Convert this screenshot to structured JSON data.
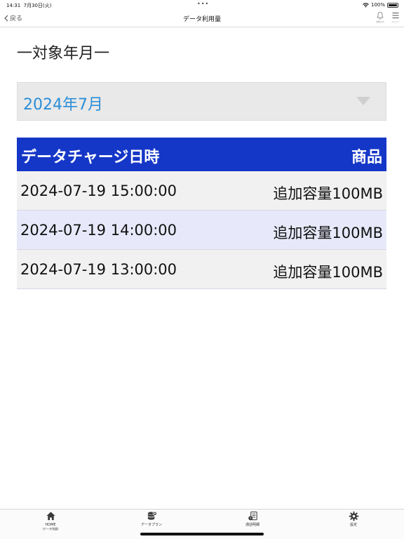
{
  "status_bar": {
    "time": "14:31",
    "date": "7月30日(火)",
    "dots": "•••",
    "battery_percent": "100%"
  },
  "nav": {
    "back_label": "戻る",
    "title": "データ利用量",
    "right_icons": [
      {
        "icon": "bell-icon",
        "label": "お知らせ"
      },
      {
        "icon": "menu-icon",
        "label": "メニュー"
      }
    ]
  },
  "section_label": "一対象年月一",
  "month_select": {
    "selected": "2024年7月"
  },
  "table": {
    "headers": [
      "データチャージ日時",
      "商品"
    ],
    "rows": [
      {
        "datetime": "2024-07-19 15:00:00",
        "product": "追加容量100MB"
      },
      {
        "datetime": "2024-07-19 14:00:00",
        "product": "追加容量100MB"
      },
      {
        "datetime": "2024-07-19 13:00:00",
        "product": "追加容量100MB"
      }
    ]
  },
  "tabs": [
    {
      "label": "HOME",
      "sub": "(データ残量)",
      "icon": "home-icon"
    },
    {
      "label": "データプラン",
      "sub": "",
      "icon": "database-icon"
    },
    {
      "label": "通話明細",
      "sub": "",
      "icon": "document-icon"
    },
    {
      "label": "設定",
      "sub": "",
      "icon": "gear-icon"
    }
  ],
  "colors": {
    "header_bg": "#1537c7",
    "select_text": "#2c8ed8",
    "row_odd": "#f1f1f1",
    "row_even": "#e7e9fa"
  }
}
